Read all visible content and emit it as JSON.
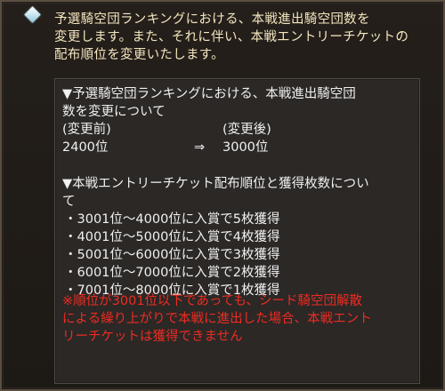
{
  "heading": {
    "lines": [
      "予選騎空団ランキングにおける、本戦進出騎空団数を",
      "変更します。また、それに伴い、本戦エントリーチケットの",
      "配布順位を変更いたします。"
    ]
  },
  "section1": {
    "title_lines": [
      "▼予選騎空団ランキングにおける、本戦進出騎空団",
      "数を変更について"
    ],
    "before_label": "(変更前)",
    "after_label": "(変更後)",
    "before_value": "2400位",
    "arrow": "⇒",
    "after_value": "3000位"
  },
  "section2": {
    "title_lines": [
      "▼本戦エントリーチケット配布順位と獲得枚数につい",
      "て"
    ],
    "items": [
      "・3001位〜4000位に入賞で5枚獲得",
      "・4001位〜5000位に入賞で4枚獲得",
      "・5001位〜6000位に入賞で3枚獲得",
      "・6001位〜7000位に入賞で2枚獲得",
      "・7001位〜8000位に入賞で1枚獲得"
    ]
  },
  "notice": {
    "lines": [
      "※順位が3001位以下であっても、シード騎空団解散",
      "による繰り上がりで本戦に進出した場合、本戦エント",
      "リーチケットは獲得できません"
    ]
  },
  "colors": {
    "heading_text": "#f4e6bf",
    "body_text": "#f0f0f0",
    "notice_text": "#ee2b22",
    "panel_bg": "#2b2826",
    "page_bg": "#1f1b17"
  },
  "icons": {
    "heading_marker": "diamond-bullet-icon"
  }
}
